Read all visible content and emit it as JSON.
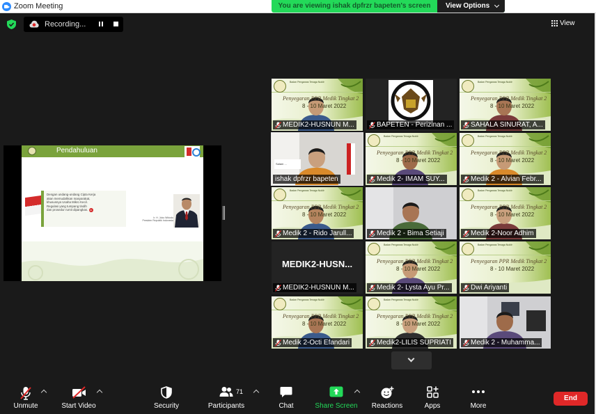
{
  "window": {
    "title": "Zoom Meeting"
  },
  "banner": {
    "viewing_text": "You are viewing ishak dpfrzr bapeten's screen",
    "view_options_label": "View Options"
  },
  "topbar": {
    "recording_label": "Recording...",
    "view_label": "View"
  },
  "slide": {
    "title": "Pendahuluan",
    "body_lines": [
      "Dengan undang-undang Cipta Kerja",
      "akan memudahkan masyarakat,",
      "khususnya Usaha Mikro Kecil.",
      "Regulasi yang tumpang tindih",
      "dan prosedur rumit dipangkas."
    ],
    "badge_text": "01",
    "speaker_name": "Ir. H. Joko Widodo",
    "speaker_title": "Presiden Republik Indonesia"
  },
  "banner_template": {
    "org": "Badan Pengawas Tenaga Nuklir",
    "title": "Penyegaran PPR Medik Tingkat 2",
    "date": "8 - 10 Maret 2022"
  },
  "participants": [
    {
      "name": "MEDIK2-HUSNUN M...",
      "muted": true,
      "kind": "banner-person"
    },
    {
      "name": "BAPETEN - Perizinan ...",
      "muted": true,
      "kind": "logo"
    },
    {
      "name": "SAHALA SINURAT, A...",
      "muted": true,
      "kind": "banner-person"
    },
    {
      "name": "ishak dpfrzr bapeten",
      "muted": false,
      "kind": "camera",
      "active": true
    },
    {
      "name": "Medik 2- IMAM SUY...",
      "muted": true,
      "kind": "banner-person"
    },
    {
      "name": "Medik 2 - Alvian Febr...",
      "muted": true,
      "kind": "banner-person"
    },
    {
      "name": "Medik 2 - Rido Jarull...",
      "muted": true,
      "kind": "banner-person"
    },
    {
      "name": "Medik 2 - Bima Setiaji",
      "muted": true,
      "kind": "camera"
    },
    {
      "name": "Medik 2-Noor Adhim",
      "muted": true,
      "kind": "banner-person"
    },
    {
      "name": "MEDIK2-HUSNUN M...",
      "muted": true,
      "kind": "name-only",
      "center_name": "MEDIK2-HUSN..."
    },
    {
      "name": "Medik 2- Lysta Ayu Pr...",
      "muted": true,
      "kind": "banner-person"
    },
    {
      "name": "Dwi Ariyanti",
      "muted": true,
      "kind": "banner"
    },
    {
      "name": "Medik 2-Octi Efandari",
      "muted": true,
      "kind": "banner-person"
    },
    {
      "name": "Medik2-LILIS SUPRIATI",
      "muted": true,
      "kind": "banner-person"
    },
    {
      "name": "Medik 2 - Muhamma...",
      "muted": true,
      "kind": "camera"
    }
  ],
  "toolbar": {
    "unmute": "Unmute",
    "start_video": "Start Video",
    "security": "Security",
    "participants": "Participants",
    "participant_count": "71",
    "chat": "Chat",
    "share_screen": "Share Screen",
    "reactions": "Reactions",
    "apps": "Apps",
    "more": "More",
    "end": "End"
  },
  "colors": {
    "share_green": "#23d959",
    "end_red": "#e02828",
    "zoom_blue": "#2d8cff"
  }
}
